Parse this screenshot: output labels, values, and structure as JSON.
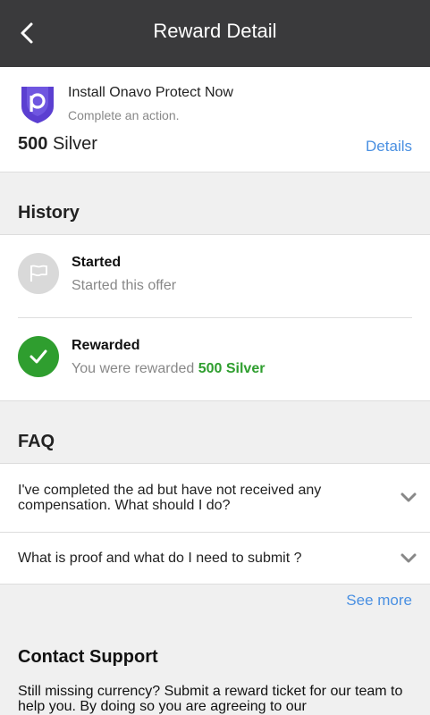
{
  "header": {
    "title": "Reward Detail"
  },
  "offer": {
    "name": "Install Onavo Protect Now",
    "subtitle": "Complete an action.",
    "amount_number": "500",
    "amount_unit": "Silver",
    "details_link": "Details",
    "logo_letter": "p",
    "logo_color": "#5b3fd1"
  },
  "history": {
    "title": "History",
    "items": [
      {
        "label": "Started",
        "desc": "Started this offer"
      },
      {
        "label": "Rewarded",
        "desc": "You were rewarded ",
        "highlight": "500 Silver"
      }
    ],
    "rewarded_color": "#2f9e2f"
  },
  "faq": {
    "title": "FAQ",
    "items": [
      {
        "question": "I've completed the ad but have not received any compensation. What should I do?"
      },
      {
        "question": "What is proof and what do I need to submit ?"
      }
    ],
    "see_more": "See more"
  },
  "contact": {
    "title": "Contact Support",
    "text": "Still missing currency? Submit a reward ticket for our team to help you. By doing so you are agreeing to our"
  },
  "colors": {
    "link": "#4a90e2",
    "topbar": "#3a3a3c"
  }
}
